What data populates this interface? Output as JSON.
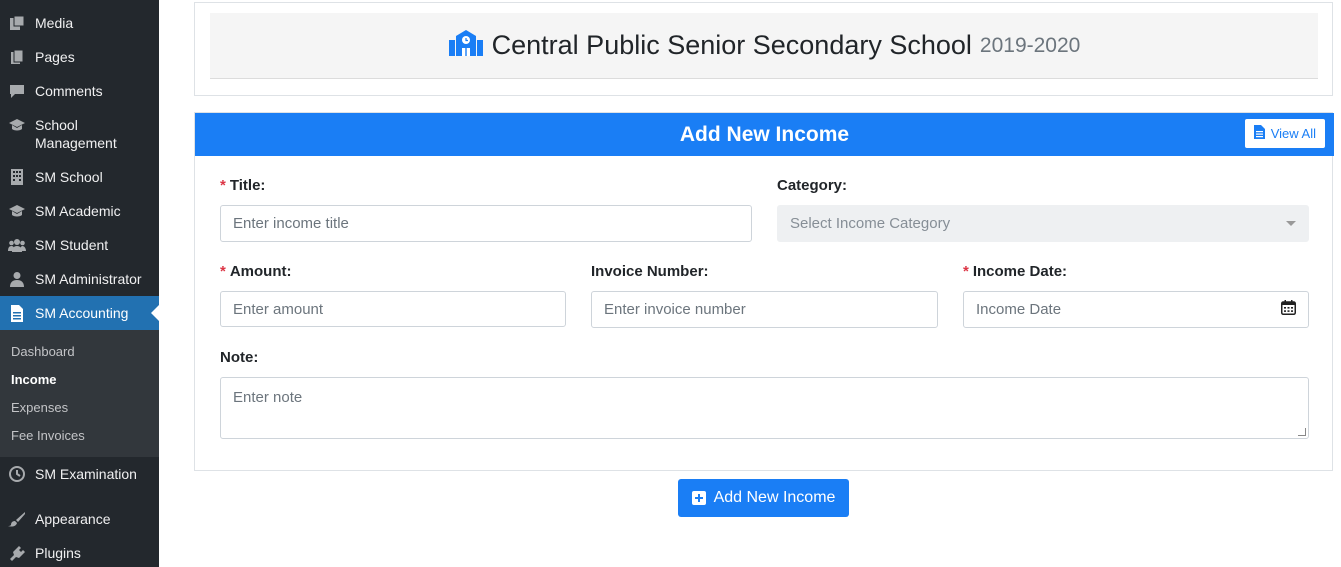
{
  "sidebar": {
    "items": [
      {
        "label": "Media",
        "icon": "media-icon"
      },
      {
        "label": "Pages",
        "icon": "pages-icon"
      },
      {
        "label": "Comments",
        "icon": "comments-icon"
      },
      {
        "label": "School Management",
        "icon": "graduation-cap-icon"
      },
      {
        "label": "SM School",
        "icon": "building-icon"
      },
      {
        "label": "SM Academic",
        "icon": "graduation-cap-icon"
      },
      {
        "label": "SM Student",
        "icon": "users-icon"
      },
      {
        "label": "SM Administrator",
        "icon": "user-icon"
      },
      {
        "label": "SM Accounting",
        "icon": "accounting-icon"
      },
      {
        "label": "SM Examination",
        "icon": "clock-icon"
      },
      {
        "label": "Appearance",
        "icon": "appearance-icon"
      },
      {
        "label": "Plugins",
        "icon": "plugins-icon"
      }
    ],
    "submenu": [
      "Dashboard",
      "Income",
      "Expenses",
      "Fee Invoices"
    ]
  },
  "school": {
    "name": "Central Public Senior Secondary School",
    "year": "2019-2020"
  },
  "form": {
    "title": "Add New Income",
    "view_all": "View All",
    "req_mark": "*",
    "fields": {
      "title_label": "Title:",
      "title_placeholder": "Enter income title",
      "category_label": "Category:",
      "category_placeholder": "Select Income Category",
      "amount_label": "Amount:",
      "amount_placeholder": "Enter amount",
      "invoice_label": "Invoice Number:",
      "invoice_placeholder": "Enter invoice number",
      "date_label": "Income Date:",
      "date_placeholder": "Income Date",
      "note_label": "Note:",
      "note_placeholder": "Enter note"
    },
    "submit": "Add New Income"
  },
  "colors": {
    "sidebar_bg": "#23282d",
    "active_bg": "#2271b1",
    "primary": "#1a7ef5",
    "required": "#dc3545"
  }
}
